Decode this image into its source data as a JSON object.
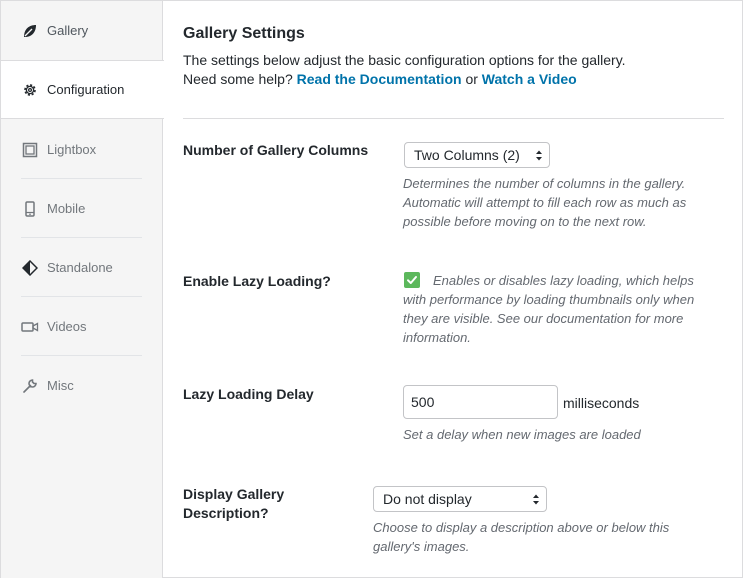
{
  "sidebar": {
    "items": [
      {
        "label": "Gallery",
        "icon": "leaf-icon"
      },
      {
        "label": "Configuration",
        "icon": "gear-icon"
      },
      {
        "label": "Lightbox",
        "icon": "lightbox-icon"
      },
      {
        "label": "Mobile",
        "icon": "mobile-icon"
      },
      {
        "label": "Standalone",
        "icon": "standalone-icon"
      },
      {
        "label": "Videos",
        "icon": "video-camera-icon"
      },
      {
        "label": "Misc",
        "icon": "wrench-icon"
      }
    ],
    "active": "Configuration"
  },
  "main": {
    "title": "Gallery Settings",
    "intro_line1": "The settings below adjust the basic configuration options for the gallery.",
    "intro_help": "Need some help?",
    "doc_link": "Read the Documentation",
    "or_text": "or",
    "video_link": "Watch a Video",
    "columns": {
      "label": "Number of Gallery Columns",
      "value": "Two Columns (2)",
      "desc_l1": "Determines the number of columns in the gallery.",
      "desc_l2": "Automatic will attempt to fill each row as much as",
      "desc_l3": "possible before moving on to the next row."
    },
    "lazy": {
      "label": "Enable Lazy Loading?",
      "checked": true,
      "desc_l1": "Enables or disables lazy loading, which helps",
      "desc_l2": "with performance by loading thumbnails only when",
      "desc_l3": "they are visible. See our documentation for more",
      "desc_l4": "information."
    },
    "delay": {
      "label": "Lazy Loading Delay",
      "value": "500",
      "unit": "milliseconds",
      "desc": "Set a delay when new images are loaded"
    },
    "description": {
      "label_l1": "Display Gallery",
      "label_l2": "Description?",
      "value": "Do not display",
      "desc_l1": "Choose to display a description above or below this",
      "desc_l2": "gallery's images."
    }
  },
  "colors": {
    "link": "#0073aa",
    "checkbox": "#5cb85c",
    "sidebar_bg": "#f5f5f5"
  }
}
